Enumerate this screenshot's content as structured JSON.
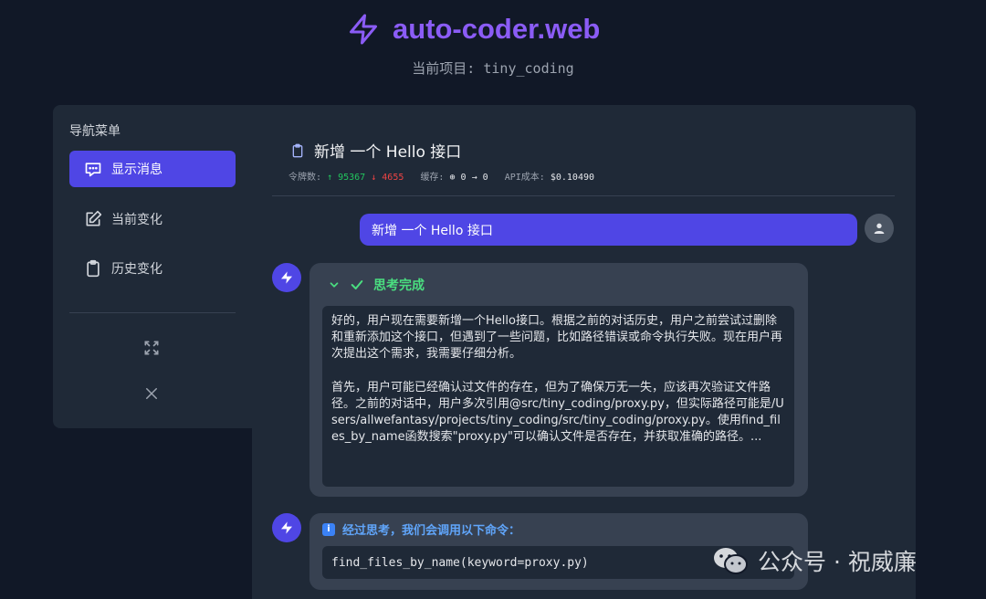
{
  "header": {
    "title": "auto-coder.web",
    "project_line": "当前项目: tiny_coding"
  },
  "sidebar": {
    "title": "导航菜单",
    "items": [
      {
        "label": "显示消息",
        "icon": "chat-icon",
        "active": true
      },
      {
        "label": "当前变化",
        "icon": "edit-icon",
        "active": false
      },
      {
        "label": "历史变化",
        "icon": "clipboard-icon",
        "active": false
      }
    ],
    "expand_icon": "expand-icon",
    "close_icon": "close-icon"
  },
  "conversation": {
    "title": "新增 一个 Hello 接口",
    "stats": {
      "tokens_label": "令牌数:",
      "tokens_up": "↑ 95367",
      "tokens_down": "↓ 4655",
      "cache_label": "缓存:",
      "cache_value": "⊕ 0 → 0",
      "cost_label": "API成本:",
      "cost_value": "$0.10490"
    },
    "user_message": "新增 一个 Hello 接口",
    "thinking": {
      "status": "思考完成",
      "content": "好的，用户现在需要新增一个Hello接口。根据之前的对话历史，用户之前尝试过删除和重新添加这个接口，但遇到了一些问题，比如路径错误或命令执行失败。现在用户再次提出这个需求，我需要仔细分析。\n\n首先，用户可能已经确认过文件的存在，但为了确保万无一失，应该再次验证文件路径。之前的对话中，用户多次引用@src/tiny_coding/proxy.py，但实际路径可能是/Users/allwefantasy/projects/tiny_coding/src/tiny_coding/proxy.py。使用find_files_by_name函数搜索\"proxy.py\"可以确认文件是否存在，并获取准确的路径。..."
    },
    "command": {
      "header": "经过思考，我们会调用以下命令：",
      "code": "find_files_by_name(keyword=proxy.py)"
    }
  },
  "watermark": "公众号 · 祝威廉",
  "colors": {
    "background": "#111827",
    "panel": "#1f2937",
    "accent": "#4f46e5",
    "brand": "#8b5cf6",
    "success": "#4ade80",
    "info": "#60a5fa"
  }
}
